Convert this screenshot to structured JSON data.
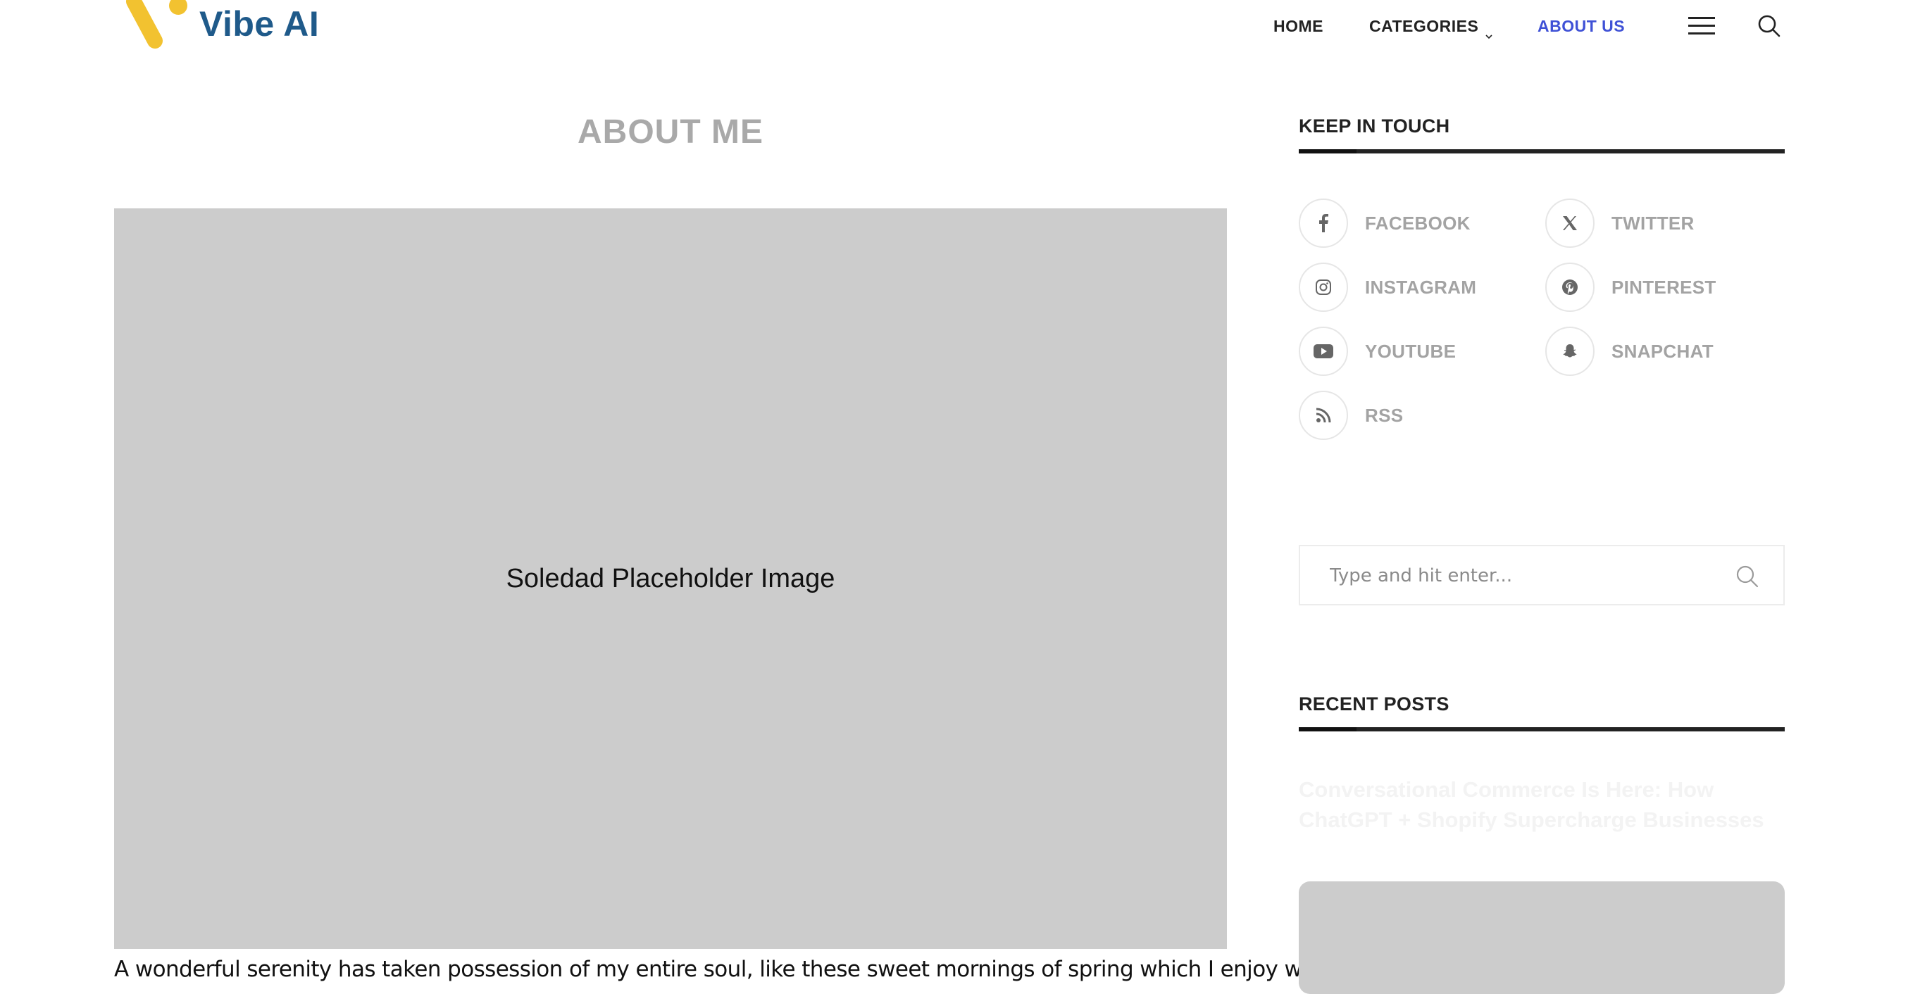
{
  "brand": {
    "name": "Vibe AI"
  },
  "nav": {
    "home": "HOME",
    "categories": "CATEGORIES",
    "about": "ABOUT US"
  },
  "page": {
    "title": "ABOUT ME",
    "image_placeholder": "Soledad Placeholder Image",
    "intro": "A wonderful serenity has taken possession of my entire soul, like these sweet mornings of spring which I enjoy with"
  },
  "sidebar": {
    "keep_in_touch": {
      "title": "KEEP IN TOUCH",
      "items": [
        {
          "label": "FACEBOOK",
          "icon": "facebook-icon"
        },
        {
          "label": "TWITTER",
          "icon": "x-icon"
        },
        {
          "label": "INSTAGRAM",
          "icon": "instagram-icon"
        },
        {
          "label": "PINTEREST",
          "icon": "pinterest-icon"
        },
        {
          "label": "YOUTUBE",
          "icon": "youtube-icon"
        },
        {
          "label": "SNAPCHAT",
          "icon": "snapchat-icon"
        },
        {
          "label": "RSS",
          "icon": "rss-icon"
        }
      ]
    },
    "search": {
      "placeholder": "Type and hit enter..."
    },
    "recent_posts": {
      "title": "RECENT POSTS",
      "first_post_title": "Conversational Commerce Is Here: How ChatGPT + Shopify Supercharge Businesses"
    }
  },
  "colors": {
    "accent": "#3f51d6",
    "logo_yellow": "#f2c230",
    "logo_blue": "#1f5a8a",
    "placeholder_gray": "#cccccc"
  }
}
